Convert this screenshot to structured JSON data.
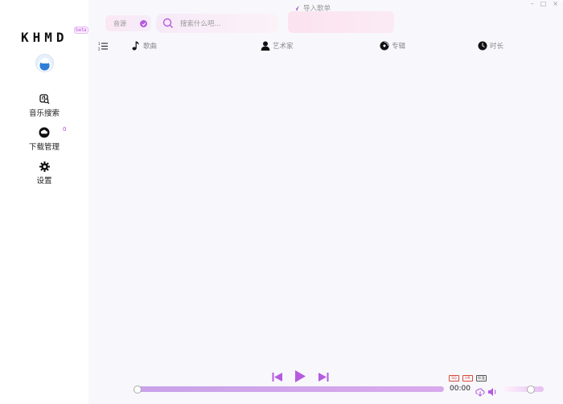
{
  "window": {
    "controls": [
      "–",
      "□",
      "×"
    ]
  },
  "sidebar": {
    "logo": "KHMD",
    "version": "beta",
    "badge_count": "0",
    "items": [
      {
        "label": "音乐搜索",
        "icon": "music-search-icon"
      },
      {
        "label": "下载管理",
        "icon": "cloud-download-icon"
      },
      {
        "label": "设置",
        "icon": "gear-icon"
      }
    ]
  },
  "topbar": {
    "import_label": "导入歌单",
    "source_label": "音源",
    "search_placeholder": "搜索什么吧..."
  },
  "list_header": {
    "song": "歌曲",
    "artist": "艺术家",
    "album": "专辑",
    "duration": "时长"
  },
  "player": {
    "time": "00:00",
    "progress": 0,
    "volume": 0.64,
    "quality_badges": [
      "SQ",
      "HR",
      "标准"
    ]
  },
  "colors": {
    "accent": "#b55be0",
    "progress": "#c9a2ea",
    "badge_red": "#d84a3a"
  }
}
